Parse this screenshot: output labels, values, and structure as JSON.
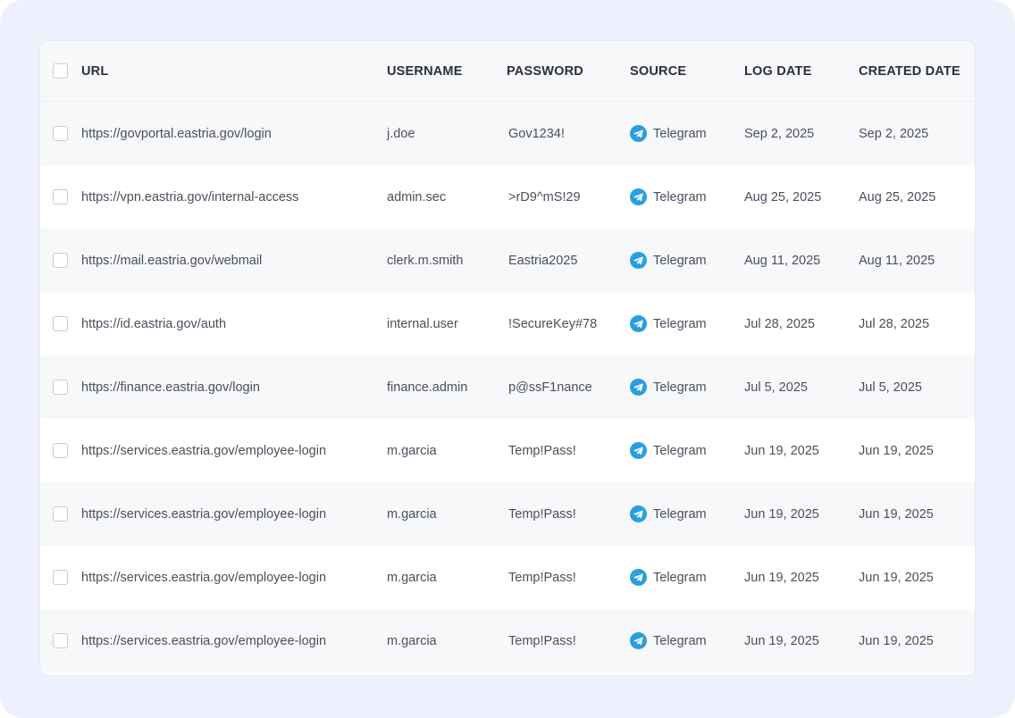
{
  "colors": {
    "page_background": "#eef1fd",
    "card_background": "#ffffff",
    "stripe": "#f7f8fa",
    "telegram_blue": "#2a9fe0",
    "header_text": "#2b2f3a",
    "body_text": "#4a4f5c"
  },
  "table": {
    "headers": {
      "url": "URL",
      "username": "USERNAME",
      "password": "PASSWORD",
      "source": "SOURCE",
      "log_date": "LOG DATE",
      "created_date": "CREATED DATE"
    },
    "rows": [
      {
        "url": "https://govportal.eastria.gov/login",
        "username": "j.doe",
        "password": "Gov1234!",
        "source": "Telegram",
        "source_icon": "telegram-icon",
        "log_date": "Sep 2, 2025",
        "created_date": "Sep 2, 2025"
      },
      {
        "url": "https://vpn.eastria.gov/internal-access",
        "username": "admin.sec",
        "password": ">rD9^mS!29",
        "source": "Telegram",
        "source_icon": "telegram-icon",
        "log_date": "Aug 25, 2025",
        "created_date": "Aug 25, 2025"
      },
      {
        "url": "https://mail.eastria.gov/webmail",
        "username": "clerk.m.smith",
        "password": "Eastria2025",
        "source": "Telegram",
        "source_icon": "telegram-icon",
        "log_date": "Aug 11, 2025",
        "created_date": "Aug 11, 2025"
      },
      {
        "url": "https://id.eastria.gov/auth",
        "username": "internal.user",
        "password": "!SecureKey#78",
        "source": "Telegram",
        "source_icon": "telegram-icon",
        "log_date": "Jul 28, 2025",
        "created_date": "Jul 28, 2025"
      },
      {
        "url": "https://finance.eastria.gov/login",
        "username": "finance.admin",
        "password": "p@ssF1nance",
        "source": "Telegram",
        "source_icon": "telegram-icon",
        "log_date": "Jul 5, 2025",
        "created_date": "Jul 5, 2025"
      },
      {
        "url": "https://services.eastria.gov/employee-login",
        "username": "m.garcia",
        "password": "Temp!Pass!",
        "source": "Telegram",
        "source_icon": "telegram-icon",
        "log_date": "Jun 19, 2025",
        "created_date": "Jun 19, 2025"
      },
      {
        "url": "https://services.eastria.gov/employee-login",
        "username": "m.garcia",
        "password": "Temp!Pass!",
        "source": "Telegram",
        "source_icon": "telegram-icon",
        "log_date": "Jun 19, 2025",
        "created_date": "Jun 19, 2025"
      },
      {
        "url": "https://services.eastria.gov/employee-login",
        "username": "m.garcia",
        "password": "Temp!Pass!",
        "source": "Telegram",
        "source_icon": "telegram-icon",
        "log_date": "Jun 19, 2025",
        "created_date": "Jun 19, 2025"
      },
      {
        "url": "https://services.eastria.gov/employee-login",
        "username": "m.garcia",
        "password": "Temp!Pass!",
        "source": "Telegram",
        "source_icon": "telegram-icon",
        "log_date": "Jun 19, 2025",
        "created_date": "Jun 19, 2025"
      }
    ]
  }
}
